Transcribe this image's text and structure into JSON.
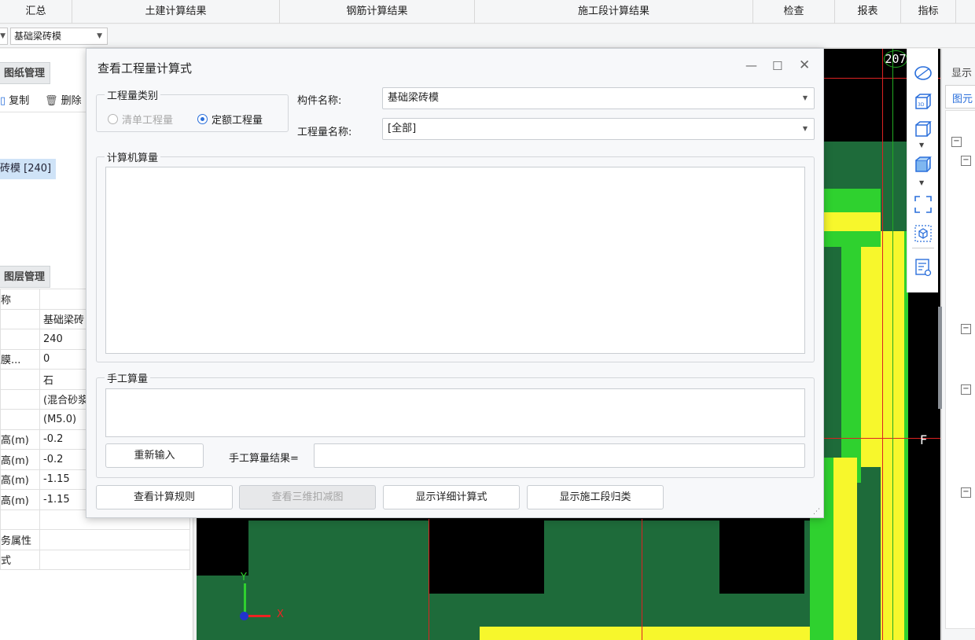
{
  "ribbon": {
    "groups": [
      "汇总",
      "土建计算结果",
      "钢筋计算结果",
      "施工段计算结果",
      "检查",
      "报表",
      "指标"
    ]
  },
  "toolbar2": {
    "component_combo": "基础梁砖模"
  },
  "left_panel": {
    "drawing_tab": "图纸管理",
    "copy_label": "复制",
    "delete_label": "删除",
    "tree_selected": "砖模 [240]",
    "layer_tab": "图层管理",
    "props": [
      {
        "k": "称",
        "v": ""
      },
      {
        "k": "",
        "v": "基础梁砖"
      },
      {
        "k": "",
        "v": "240"
      },
      {
        "k": "膜...",
        "v": "0"
      },
      {
        "k": "",
        "v": "石"
      },
      {
        "k": "",
        "v": "(混合砂浆"
      },
      {
        "k": "",
        "v": "(M5.0)"
      },
      {
        "k": "高(m)",
        "v": "-0.2"
      },
      {
        "k": "高(m)",
        "v": "-0.2"
      },
      {
        "k": "高(m)",
        "v": "-1.15"
      },
      {
        "k": "高(m)",
        "v": "-1.15"
      },
      {
        "k": "",
        "v": ""
      },
      {
        "k": "务属性",
        "v": ""
      },
      {
        "k": "式",
        "v": ""
      }
    ]
  },
  "canvas": {
    "label_top": "207",
    "label_f": "F",
    "axis_x": "X",
    "axis_y": "Y"
  },
  "right_panel": {
    "tab1": "显示",
    "tab2": "图元"
  },
  "dialog": {
    "title": "查看工程量计算式",
    "qty_type_legend": "工程量类别",
    "radio_bill": "清单工程量",
    "radio_quota": "定额工程量",
    "component_label": "构件名称:",
    "component_value": "基础梁砖模",
    "qty_name_label": "工程量名称:",
    "qty_name_value": "[全部]",
    "computer_legend": "计算机算量",
    "manual_legend": "手工算量",
    "reenter_button": "重新输入",
    "manual_result_label": "手工算量结果=",
    "btn_rules": "查看计算规则",
    "btn_3d": "查看三维扣减图",
    "btn_detail": "显示详细计算式",
    "btn_stage": "显示施工段归类"
  }
}
